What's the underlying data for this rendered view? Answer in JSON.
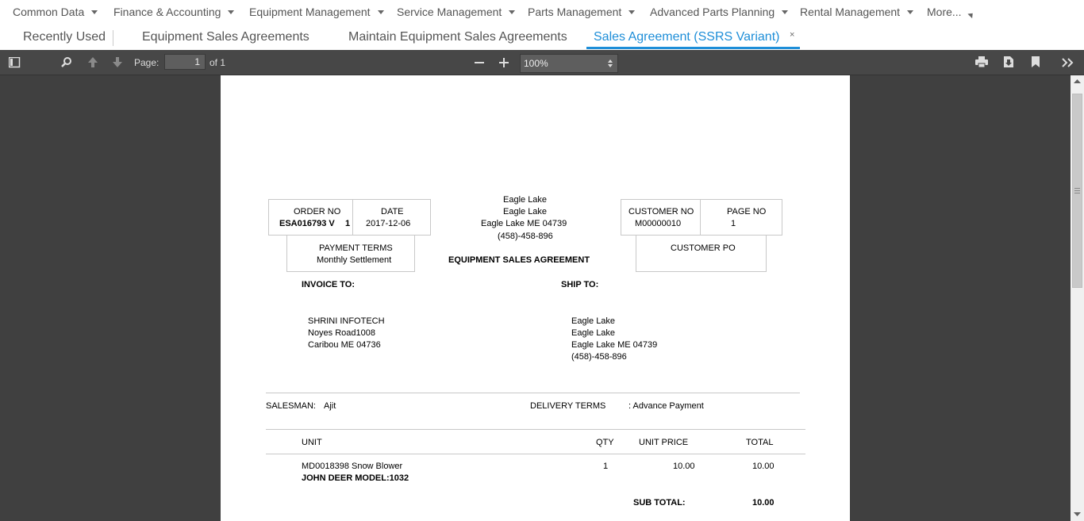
{
  "nav": {
    "items": [
      "Common Data",
      "Finance & Accounting",
      "Equipment Management",
      "Service Management",
      "Parts Management",
      "Advanced Parts Planning",
      "Rental Management"
    ],
    "more": "More..."
  },
  "tabs": {
    "recent": "Recently Used",
    "t1": "Equipment Sales Agreements",
    "t2": "Maintain Equipment Sales Agreements",
    "t3": "Sales Agreement (SSRS Variant)",
    "close": "×"
  },
  "toolbar": {
    "page_label": "Page:",
    "page_value": "1",
    "page_of": "of 1",
    "zoom": "100%"
  },
  "doc": {
    "order_no_label": "ORDER NO",
    "order_no": "ESA016793 V",
    "order_rev": "1",
    "date_label": "DATE",
    "date": "2017-12-06",
    "company": {
      "line1": "Eagle Lake",
      "line2": "Eagle Lake",
      "line3": "Eagle Lake  ME 04739",
      "line4": "(458)-458-896"
    },
    "customer_no_label": "CUSTOMER NO",
    "customer_no": "M00000010",
    "page_no_label": "PAGE NO",
    "page_no": "1",
    "payment_terms_label": "PAYMENT TERMS",
    "payment_terms": "Monthly Settlement",
    "title": "EQUIPMENT SALES AGREEMENT",
    "customer_po_label": "CUSTOMER PO",
    "invoice_to_label": "INVOICE TO:",
    "ship_to_label": "SHIP TO:",
    "invoice_to": {
      "line1": "SHRINI INFOTECH",
      "line2": "Noyes Road1008",
      "line3": "Caribou  ME 04736"
    },
    "ship_to": {
      "line1": "Eagle Lake",
      "line2": "Eagle Lake",
      "line3": "Eagle Lake  ME 04739",
      "line4": "(458)-458-896"
    },
    "salesman_label": "SALESMAN:",
    "salesman": "Ajit",
    "delivery_terms_label": "DELIVERY TERMS",
    "delivery_terms": ": Advance Payment",
    "table_headers": {
      "unit": "UNIT",
      "qty": "QTY",
      "unit_price": "UNIT PRICE",
      "total": "TOTAL"
    },
    "lines": [
      {
        "unit": "MD0018398 Snow Blower",
        "model": "JOHN DEER MODEL:1032",
        "qty": "1",
        "unit_price": "10.00",
        "total": "10.00"
      }
    ],
    "subtotal_label": "SUB TOTAL:",
    "subtotal": "10.00"
  }
}
